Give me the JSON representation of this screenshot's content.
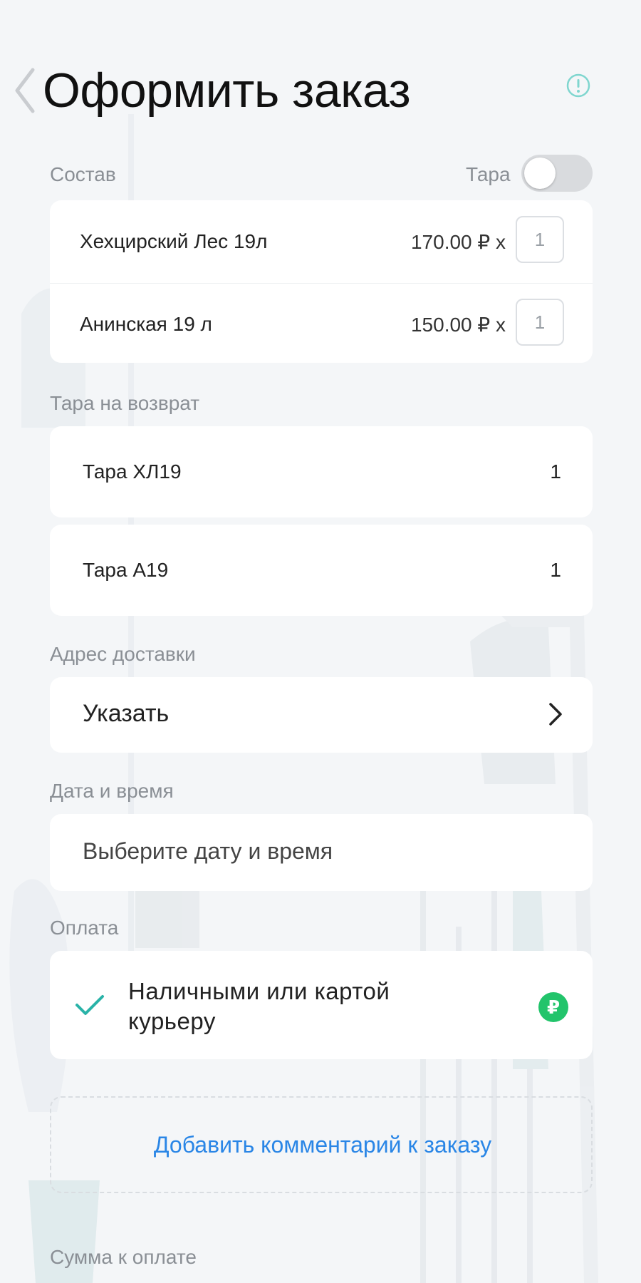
{
  "header": {
    "title": "Оформить заказ",
    "back_icon": "chevron-left-icon",
    "info_icon": "info-icon"
  },
  "composition": {
    "label": "Состав",
    "tara_toggle_label": "Тара",
    "tara_toggle_on": false,
    "items": [
      {
        "name": "Хехцирский Лес 19л",
        "price": "170.00 ₽ x",
        "qty": "1"
      },
      {
        "name": "Анинская 19 л",
        "price": "150.00 ₽ x",
        "qty": "1"
      }
    ]
  },
  "return_tara": {
    "label": "Тара на возврат",
    "items": [
      {
        "name": "Тара ХЛ19",
        "count": "1"
      },
      {
        "name": "Тара А19",
        "count": "1"
      }
    ]
  },
  "address": {
    "label": "Адрес доставки",
    "value": "Указать"
  },
  "datetime": {
    "label": "Дата и время",
    "placeholder": "Выберите дату и время"
  },
  "payment": {
    "label": "Оплата",
    "method_line1": "Наличными или картой",
    "method_line2": "курьеру",
    "method_icon": "ruble-icon",
    "ruble_symbol": "₽"
  },
  "comment": {
    "link_text": "Добавить комментарий к заказу"
  },
  "total": {
    "label": "Сумма к оплате"
  },
  "colors": {
    "accent_blue": "#2a86e6",
    "check_teal": "#2ab3a8",
    "ruble_green": "#22c46b",
    "info_teal": "#7fd6cf"
  }
}
